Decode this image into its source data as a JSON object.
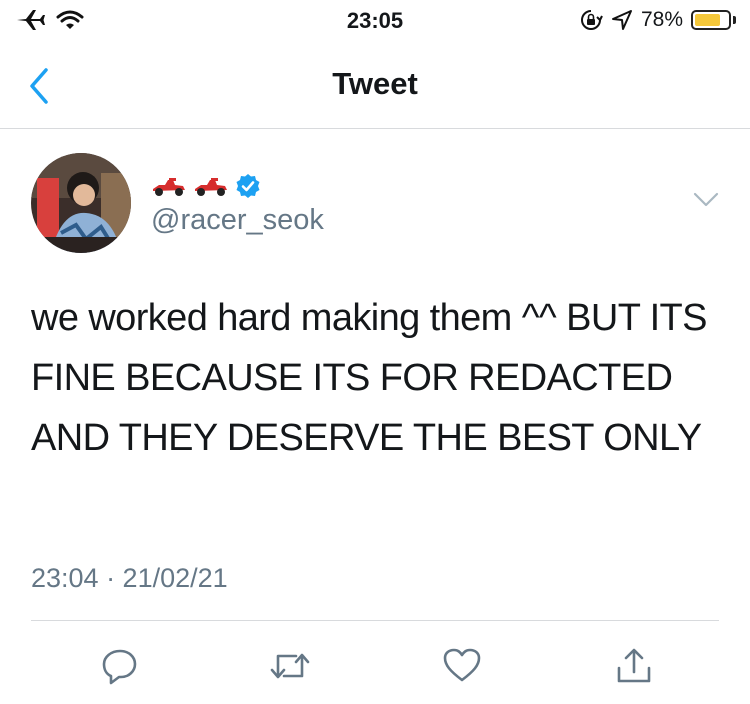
{
  "status_bar": {
    "time": "23:05",
    "battery_percent": "78%",
    "battery_level": 0.78,
    "battery_color": "#f4c73a",
    "icons": [
      "airplane-icon",
      "wifi-icon",
      "orientation-lock-icon",
      "location-icon",
      "battery-icon"
    ]
  },
  "nav": {
    "title": "Tweet",
    "back_icon": "chevron-left-icon",
    "accent_color": "#1da1f2"
  },
  "tweet": {
    "display_name_icons": [
      "race-car-icon",
      "race-car-icon",
      "verified-badge-icon"
    ],
    "handle": "@racer_seok",
    "text": "we worked hard making them ^^ BUT ITS FINE BECAUSE ITS FOR REDACTED AND THEY DESERVE THE BEST ONLY",
    "timestamp": "23:04 · 21/02/21",
    "actions": [
      "reply-icon",
      "retweet-icon",
      "like-icon",
      "share-icon"
    ]
  }
}
